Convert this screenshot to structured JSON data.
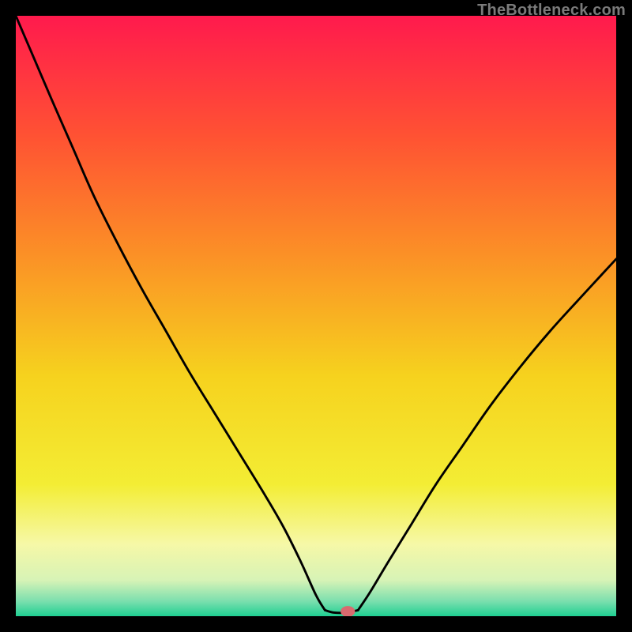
{
  "watermark": "TheBottleneck.com",
  "chart_data": {
    "type": "line",
    "title": "",
    "xlabel": "",
    "ylabel": "",
    "xlim": [
      0,
      100
    ],
    "ylim": [
      0,
      100
    ],
    "grid": false,
    "background_gradient_stops": [
      {
        "offset": 0.0,
        "color": "#ff1a4d"
      },
      {
        "offset": 0.2,
        "color": "#ff5233"
      },
      {
        "offset": 0.4,
        "color": "#fb9126"
      },
      {
        "offset": 0.6,
        "color": "#f6d21e"
      },
      {
        "offset": 0.78,
        "color": "#f3ed34"
      },
      {
        "offset": 0.88,
        "color": "#f6f8a7"
      },
      {
        "offset": 0.94,
        "color": "#d7f3b6"
      },
      {
        "offset": 0.975,
        "color": "#7bdfae"
      },
      {
        "offset": 1.0,
        "color": "#1fcf92"
      }
    ],
    "series": [
      {
        "name": "curve-left",
        "x": [
          0.0,
          3.0,
          6.0,
          9.5,
          13.0,
          17.0,
          21.0,
          25.0,
          29.0,
          33.0,
          37.0,
          41.0,
          44.5,
          47.5,
          50.0,
          51.5
        ],
        "y": [
          100.0,
          93.0,
          86.0,
          78.0,
          70.0,
          62.0,
          54.5,
          47.5,
          40.5,
          34.0,
          27.5,
          21.0,
          15.0,
          9.0,
          3.5,
          1.0
        ]
      },
      {
        "name": "valley-floor",
        "x": [
          51.5,
          53.0,
          55.0,
          57.0
        ],
        "y": [
          1.0,
          0.6,
          0.6,
          1.0
        ]
      },
      {
        "name": "curve-right",
        "x": [
          57.0,
          59.0,
          62.0,
          66.0,
          70.0,
          74.5,
          79.0,
          84.0,
          89.0,
          94.0,
          100.0
        ],
        "y": [
          1.0,
          4.0,
          9.0,
          15.5,
          22.0,
          28.5,
          35.0,
          41.5,
          47.5,
          53.0,
          59.5
        ]
      }
    ],
    "marker": {
      "name": "minimum-marker",
      "x": 55.3,
      "y": 0.8,
      "rx": 1.2,
      "ry": 0.9,
      "color": "#d96a6f"
    }
  }
}
